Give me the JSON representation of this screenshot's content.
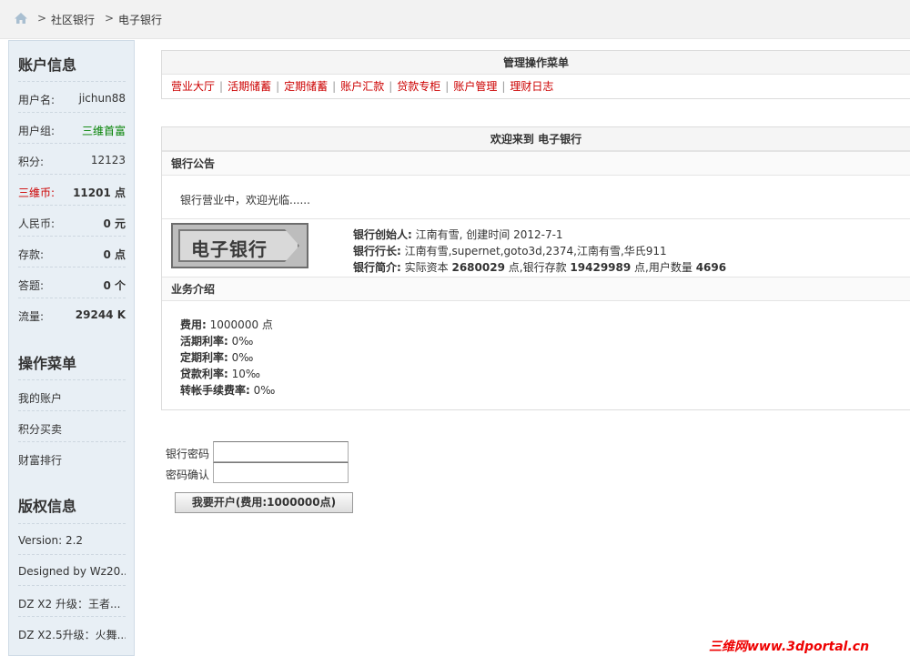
{
  "breadcrumb": {
    "sep1": ">",
    "item1": "社区银行",
    "sep2": ">",
    "item2": "电子银行"
  },
  "sidebar": {
    "account_title": "账户信息",
    "rows": [
      {
        "label": "用户名:",
        "value": "jichun88"
      },
      {
        "label": "用户组:",
        "value": "三维首富"
      },
      {
        "label": "积分:",
        "value": "12123"
      },
      {
        "label": "三维币:",
        "value": "11201 点"
      },
      {
        "label": "人民币:",
        "value": "0 元"
      },
      {
        "label": "存款:",
        "value": "0 点"
      },
      {
        "label": "答题:",
        "value": "0 个"
      },
      {
        "label": "流量:",
        "value": "29244 K"
      }
    ],
    "ops_title": "操作菜单",
    "ops": [
      "我的账户",
      "积分买卖",
      "财富排行"
    ],
    "copyright_title": "版权信息",
    "copyright": [
      "Version: 2.2",
      "Designed by Wz20...",
      "DZ X2 升级：王者...",
      "DZ X2.5升级：火舞..."
    ],
    "colors": {
      "group": "#008000",
      "coin": "#cc0000"
    }
  },
  "admin_menu": {
    "title": "管理操作菜单",
    "items": [
      "营业大厅",
      "活期储蓄",
      "定期储蓄",
      "账户汇款",
      "贷款专柜",
      "账户管理",
      "理财日志"
    ],
    "sep": "|"
  },
  "welcome": {
    "title": "欢迎来到 电子银行",
    "notice_head": "银行公告",
    "notice_text": "银行营业中，欢迎光临......",
    "logo_text": "电子银行",
    "founder_label": "银行创始人:",
    "founder_value": "江南有雪, 创建时间 2012-7-1",
    "president_label": "银行行长:",
    "president_value": "江南有雪,supernet,goto3d,2374,江南有雪,华氏911",
    "intro_label": "银行简介:",
    "intro_p1": "实际资本",
    "intro_capital": "2680029",
    "intro_p2": "点,银行存款",
    "intro_deposit": "19429989",
    "intro_p3": "点,用户数量",
    "intro_users": "4696",
    "biz_head": "业务介绍",
    "biz": [
      {
        "label": "费用:",
        "value": "1000000 点"
      },
      {
        "label": "活期利率:",
        "value": "0‰"
      },
      {
        "label": "定期利率:",
        "value": "0‰"
      },
      {
        "label": "贷款利率:",
        "value": "10‰"
      },
      {
        "label": "转帐手续费率:",
        "value": "0‰"
      }
    ]
  },
  "form": {
    "password_label": "银行密码",
    "confirm_label": "密码确认",
    "submit_label": "我要开户(费用:1000000点)"
  },
  "watermark": "三维网www.3dportal.cn"
}
